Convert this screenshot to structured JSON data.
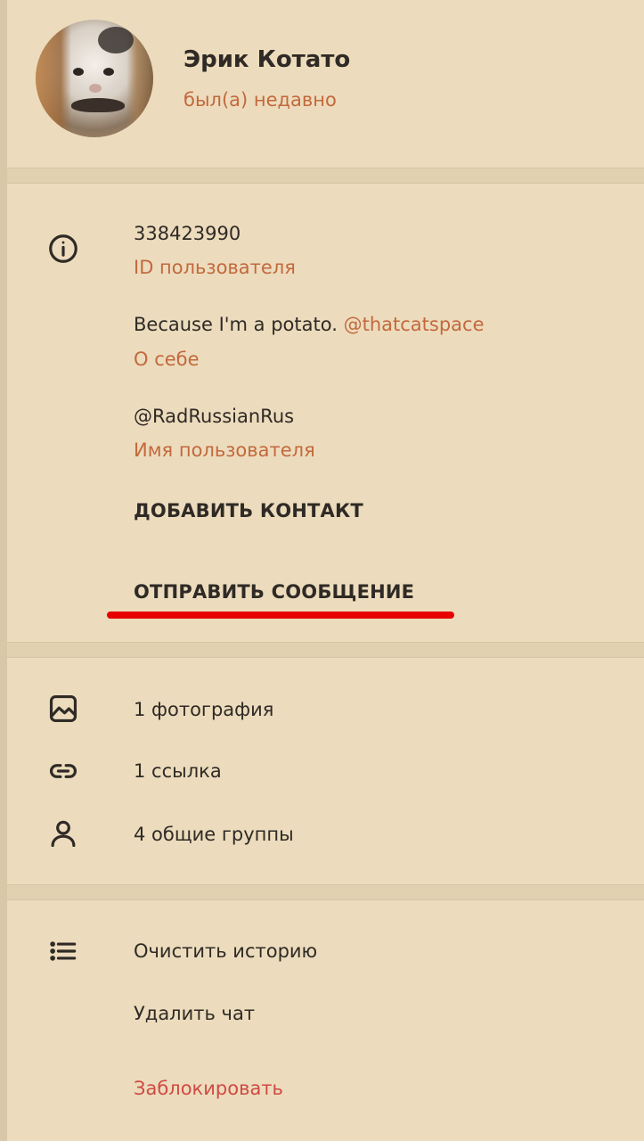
{
  "profile": {
    "name": "Эрик Котато",
    "status": "был(а) недавно"
  },
  "info": {
    "user_id": "338423990",
    "user_id_label": "ID пользователя",
    "bio_text": "Because I'm a potato.",
    "bio_link": "@thatcatspace",
    "bio_label": "О себе",
    "username": "@RadRussianRus",
    "username_label": "Имя пользователя",
    "add_contact": "ДОБАВИТЬ КОНТАКТ",
    "send_message": "ОТПРАВИТЬ СООБЩЕНИЕ"
  },
  "media": {
    "photos": "1 фотография",
    "links": "1 ссылка",
    "groups": "4 общие группы"
  },
  "actions": {
    "clear_history": "Очистить историю",
    "delete_chat": "Удалить чат",
    "block": "Заблокировать"
  },
  "icons": {
    "info": "info-icon",
    "photo": "photo-icon",
    "link": "link-icon",
    "groups": "user-icon",
    "list": "list-icon"
  },
  "colors": {
    "background": "#ecdcbd",
    "accent": "#c2693d",
    "danger": "#d04a43",
    "highlight_underline": "#e60000",
    "text": "#2f2a25"
  }
}
